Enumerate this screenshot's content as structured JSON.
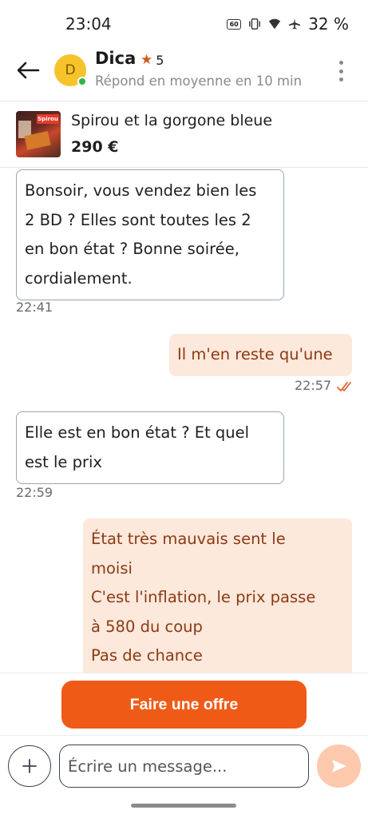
{
  "status_bar": {
    "time": "23:04",
    "network_badge": "60",
    "battery": "32 %"
  },
  "header": {
    "avatar_initial": "D",
    "seller_name": "Dica",
    "rating_count": "5",
    "response_time": "Répond en moyenne en 10 min",
    "accent_color": "#d35a1c",
    "online_color": "#2fb34a"
  },
  "product": {
    "title": "Spirou et la gorgone bleue",
    "price": "290 €"
  },
  "messages": [
    {
      "direction": "incoming",
      "lines": [
        "Bonsoir, vous vendez bien les",
        "2 BD ? Elles sont toutes les 2",
        "en bon état ? Bonne soirée,",
        "cordialement."
      ],
      "time": "22:41"
    },
    {
      "direction": "outgoing",
      "lines": [
        "Il m'en reste qu'une"
      ],
      "time": "22:57",
      "read": true
    },
    {
      "direction": "incoming",
      "lines": [
        "Elle est en bon état ? Et quel",
        "est le prix"
      ],
      "time": "22:59"
    },
    {
      "direction": "outgoing",
      "lines": [
        "État très mauvais sent le",
        "moisi",
        "C'est l'inflation, le prix passe",
        "à 580 du coup",
        "Pas de chance"
      ],
      "time": ""
    }
  ],
  "actions": {
    "offer_label": "Faire une offre",
    "offer_color": "#ef5b17"
  },
  "composer": {
    "placeholder": "Écrire un message...",
    "send_color": "#fcc9ac"
  }
}
